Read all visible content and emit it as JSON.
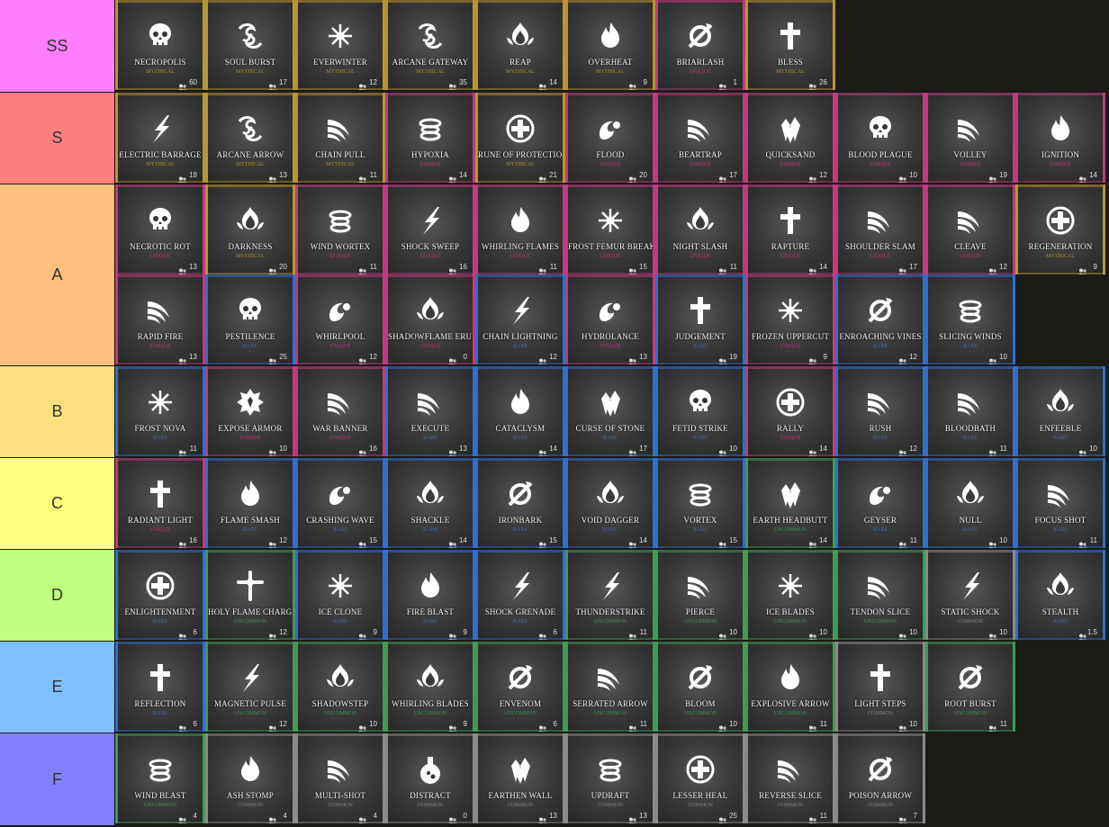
{
  "rarity_colors": {
    "Mythical": "#b8962f",
    "Unique": "#c2397f",
    "Rare": "#2e6fd0",
    "Uncommon": "#3f9b55",
    "Common": "#8a8a8a"
  },
  "tiers": [
    {
      "label": "SS",
      "color": "#ff7fff",
      "items": [
        {
          "name": "Necropolis",
          "icon": "skull-icon",
          "rarity": "Mythical",
          "count": "60"
        },
        {
          "name": "Soul Burst",
          "icon": "spirits-icon",
          "rarity": "Mythical",
          "count": "17"
        },
        {
          "name": "Everwinter",
          "icon": "snowflake-icon",
          "rarity": "Mythical",
          "count": "12"
        },
        {
          "name": "Arcane Gateway",
          "icon": "spirits-icon",
          "rarity": "Mythical",
          "count": "35"
        },
        {
          "name": "Reap",
          "icon": "lotus-flame-icon",
          "rarity": "Mythical",
          "count": "14"
        },
        {
          "name": "Overheat",
          "icon": "fire-icon",
          "rarity": "Mythical",
          "count": "9"
        },
        {
          "name": "Briarlash",
          "icon": "thorn-icon",
          "rarity": "Unique",
          "count": "1"
        },
        {
          "name": "Bless",
          "icon": "cross-icon",
          "rarity": "Mythical",
          "count": "26"
        }
      ]
    },
    {
      "label": "S",
      "color": "#ff7f7f",
      "items": [
        {
          "name": "Electric Barrage",
          "icon": "lightning-icon",
          "rarity": "Mythical",
          "count": "19"
        },
        {
          "name": "Arcane Arrow",
          "icon": "spirits-icon",
          "rarity": "Mythical",
          "count": "13"
        },
        {
          "name": "Chain Pull",
          "icon": "claw-icon",
          "rarity": "Mythical",
          "count": "11"
        },
        {
          "name": "Hypoxia",
          "icon": "wind-icon",
          "rarity": "Unique",
          "count": "14"
        },
        {
          "name": "Rune of Protection",
          "icon": "medic-cross-icon",
          "rarity": "Mythical",
          "count": "21"
        },
        {
          "name": "Flood",
          "icon": "wave-icon",
          "rarity": "Unique",
          "count": "20"
        },
        {
          "name": "Beartrap",
          "icon": "claw-icon",
          "rarity": "Unique",
          "count": "17"
        },
        {
          "name": "Quicksand",
          "icon": "crystal-icon",
          "rarity": "Unique",
          "count": "12"
        },
        {
          "name": "Blood Plague",
          "icon": "skull-icon",
          "rarity": "Unique",
          "count": "10"
        },
        {
          "name": "Volley",
          "icon": "claw-icon",
          "rarity": "Unique",
          "count": "19"
        },
        {
          "name": "Ignition",
          "icon": "fire-icon",
          "rarity": "Unique",
          "count": "14"
        }
      ]
    },
    {
      "label": "A",
      "color": "#ffbf7f",
      "items": [
        {
          "name": "Necrotic Rot",
          "icon": "skull-icon",
          "rarity": "Unique",
          "count": "13"
        },
        {
          "name": "Darkness",
          "icon": "lotus-flame-icon",
          "rarity": "Mythical",
          "count": "20"
        },
        {
          "name": "Wind Wortex",
          "icon": "wind-icon",
          "rarity": "Unique",
          "count": "11"
        },
        {
          "name": "Shock Sweep",
          "icon": "lightning-icon",
          "rarity": "Unique",
          "count": "16"
        },
        {
          "name": "Whirling Flames",
          "icon": "fire-icon",
          "rarity": "Unique",
          "count": "11"
        },
        {
          "name": "Frost Femur Breaker",
          "icon": "snowflake-icon",
          "rarity": "Unique",
          "count": "15"
        },
        {
          "name": "Night Slash",
          "icon": "lotus-flame-icon",
          "rarity": "Unique",
          "count": "11"
        },
        {
          "name": "Rapture",
          "icon": "cross-icon",
          "rarity": "Unique",
          "count": "14"
        },
        {
          "name": "Shoulder Slam",
          "icon": "claw-icon",
          "rarity": "Unique",
          "count": "17"
        },
        {
          "name": "Cleave",
          "icon": "claw-icon",
          "rarity": "Unique",
          "count": "12"
        },
        {
          "name": "Regeneration",
          "icon": "medic-cross-icon",
          "rarity": "Mythical",
          "count": "9"
        },
        {
          "name": "Rapid Fire",
          "icon": "claw-icon",
          "rarity": "Unique",
          "count": "13"
        },
        {
          "name": "Pestilence",
          "icon": "skull-icon",
          "rarity": "Rare",
          "count": "25"
        },
        {
          "name": "Whirlpool",
          "icon": "wave-icon",
          "rarity": "Unique",
          "count": "12"
        },
        {
          "name": "Shadowflame Eruption",
          "icon": "lotus-flame-icon",
          "rarity": "Unique",
          "count": "0"
        },
        {
          "name": "Chain Lightning",
          "icon": "lightning-icon",
          "rarity": "Rare",
          "count": "12"
        },
        {
          "name": "Hydrolance",
          "icon": "wave-icon",
          "rarity": "Unique",
          "count": "13"
        },
        {
          "name": "Judgement",
          "icon": "cross-icon",
          "rarity": "Rare",
          "count": "19"
        },
        {
          "name": "Frozen Uppercut",
          "icon": "snowflake-icon",
          "rarity": "Unique",
          "count": "9"
        },
        {
          "name": "Enroaching Vines",
          "icon": "thorn-icon",
          "rarity": "Rare",
          "count": "12"
        },
        {
          "name": "Slicing Winds",
          "icon": "wind-icon",
          "rarity": "Rare",
          "count": "10"
        }
      ]
    },
    {
      "label": "B",
      "color": "#ffdf7f",
      "items": [
        {
          "name": "Frost Nova",
          "icon": "snowflake-icon",
          "rarity": "Rare",
          "count": "11"
        },
        {
          "name": "Expose Armor",
          "icon": "armor-icon",
          "rarity": "Unique",
          "count": "10"
        },
        {
          "name": "War Banner",
          "icon": "claw-icon",
          "rarity": "Unique",
          "count": "16"
        },
        {
          "name": "Execute",
          "icon": "claw-icon",
          "rarity": "Rare",
          "count": "13"
        },
        {
          "name": "Cataclysm",
          "icon": "fire-icon",
          "rarity": "Rare",
          "count": "14"
        },
        {
          "name": "Curse of Stone",
          "icon": "crystal-icon",
          "rarity": "Rare",
          "count": "17"
        },
        {
          "name": "Fetid Strike",
          "icon": "skull-icon",
          "rarity": "Rare",
          "count": "10"
        },
        {
          "name": "Rally",
          "icon": "medic-cross-icon",
          "rarity": "Unique",
          "count": "14"
        },
        {
          "name": "Rush",
          "icon": "claw-icon",
          "rarity": "Rare",
          "count": "12"
        },
        {
          "name": "Bloodbath",
          "icon": "claw-icon",
          "rarity": "Rare",
          "count": "11"
        },
        {
          "name": "Enfeeble",
          "icon": "lotus-flame-icon",
          "rarity": "Rare",
          "count": "10"
        }
      ]
    },
    {
      "label": "C",
      "color": "#ffff7f",
      "items": [
        {
          "name": "Radiant Light",
          "icon": "cross-icon",
          "rarity": "Unique",
          "count": "16"
        },
        {
          "name": "Flame Smash",
          "icon": "fire-icon",
          "rarity": "Rare",
          "count": "12"
        },
        {
          "name": "Crashing Wave",
          "icon": "wave-icon",
          "rarity": "Rare",
          "count": "15"
        },
        {
          "name": "Shackle",
          "icon": "lotus-flame-icon",
          "rarity": "Rare",
          "count": "14"
        },
        {
          "name": "Ironbark",
          "icon": "thorn-icon",
          "rarity": "Rare",
          "count": "15"
        },
        {
          "name": "Void Dagger",
          "icon": "lotus-flame-icon",
          "rarity": "Rare",
          "count": "14"
        },
        {
          "name": "Vortex",
          "icon": "wind-icon",
          "rarity": "Rare",
          "count": "15"
        },
        {
          "name": "Earth Headbutt",
          "icon": "crystal-icon",
          "rarity": "Uncommon",
          "count": "14"
        },
        {
          "name": "Geyser",
          "icon": "wave-icon",
          "rarity": "Rare",
          "count": "11"
        },
        {
          "name": "Null",
          "icon": "lotus-flame-icon",
          "rarity": "Rare",
          "count": "10"
        },
        {
          "name": "Focus Shot",
          "icon": "claw-icon",
          "rarity": "Rare",
          "count": "11"
        }
      ]
    },
    {
      "label": "D",
      "color": "#bfff7f",
      "items": [
        {
          "name": "Enlightenment",
          "icon": "medic-cross-icon",
          "rarity": "Rare",
          "count": "6"
        },
        {
          "name": "Holy Flame Charge",
          "icon": "ornate-cross-icon",
          "rarity": "Uncommon",
          "count": "12"
        },
        {
          "name": "Ice Clone",
          "icon": "snowflake-icon",
          "rarity": "Rare",
          "count": "9"
        },
        {
          "name": "Fire Blast",
          "icon": "fire-icon",
          "rarity": "Rare",
          "count": "9"
        },
        {
          "name": "Shock Grenade",
          "icon": "lightning-icon",
          "rarity": "Rare",
          "count": "6"
        },
        {
          "name": "Thunderstrike",
          "icon": "lightning-icon",
          "rarity": "Uncommon",
          "count": "11"
        },
        {
          "name": "Pierce",
          "icon": "claw-icon",
          "rarity": "Uncommon",
          "count": "10"
        },
        {
          "name": "Ice Blades",
          "icon": "snowflake-icon",
          "rarity": "Uncommon",
          "count": "10"
        },
        {
          "name": "Tendon Slice",
          "icon": "claw-icon",
          "rarity": "Uncommon",
          "count": "10"
        },
        {
          "name": "Static Shock",
          "icon": "lightning-icon",
          "rarity": "Common",
          "count": "10"
        },
        {
          "name": "Stealth",
          "icon": "lotus-flame-icon",
          "rarity": "Rare",
          "count": "1.5"
        }
      ]
    },
    {
      "label": "E",
      "color": "#7fbfff",
      "items": [
        {
          "name": "Reflection",
          "icon": "cross-icon",
          "rarity": "Rare",
          "count": "6"
        },
        {
          "name": "Magnetic Pulse",
          "icon": "lightning-icon",
          "rarity": "Uncommon",
          "count": "12"
        },
        {
          "name": "Shadowstep",
          "icon": "lotus-flame-icon",
          "rarity": "Uncommon",
          "count": "10"
        },
        {
          "name": "Whirling Blades",
          "icon": "lotus-flame-icon",
          "rarity": "Uncommon",
          "count": "9"
        },
        {
          "name": "Envenom",
          "icon": "thorn-icon",
          "rarity": "Uncommon",
          "count": "6"
        },
        {
          "name": "Serrated Arrow",
          "icon": "claw-icon",
          "rarity": "Uncommon",
          "count": "11"
        },
        {
          "name": "Bloom",
          "icon": "thorn-icon",
          "rarity": "Uncommon",
          "count": "10"
        },
        {
          "name": "Explosive Arrow",
          "icon": "fire-icon",
          "rarity": "Uncommon",
          "count": "11"
        },
        {
          "name": "Light Steps",
          "icon": "cross-icon",
          "rarity": "Common",
          "count": "10"
        },
        {
          "name": "Root Burst",
          "icon": "thorn-icon",
          "rarity": "Uncommon",
          "count": "11"
        }
      ]
    },
    {
      "label": "F",
      "color": "#7f7fff",
      "items": [
        {
          "name": "Wind Blast",
          "icon": "wind-icon",
          "rarity": "Uncommon",
          "count": "4"
        },
        {
          "name": "Ash Stomp",
          "icon": "fire-icon",
          "rarity": "Common",
          "count": "4"
        },
        {
          "name": "Multi-Shot",
          "icon": "claw-icon",
          "rarity": "Common",
          "count": "4"
        },
        {
          "name": "Distract",
          "icon": "potion-icon",
          "rarity": "Common",
          "count": "0"
        },
        {
          "name": "Earthen Wall",
          "icon": "crystal-icon",
          "rarity": "Common",
          "count": "13"
        },
        {
          "name": "Updraft",
          "icon": "wind-icon",
          "rarity": "Common",
          "count": "13"
        },
        {
          "name": "Lesser Heal",
          "icon": "medic-cross-icon",
          "rarity": "Common",
          "count": "25"
        },
        {
          "name": "Reverse Slice",
          "icon": "claw-icon",
          "rarity": "Common",
          "count": "11"
        },
        {
          "name": "Poison Arrow",
          "icon": "thorn-icon",
          "rarity": "Common",
          "count": "7"
        }
      ]
    }
  ]
}
